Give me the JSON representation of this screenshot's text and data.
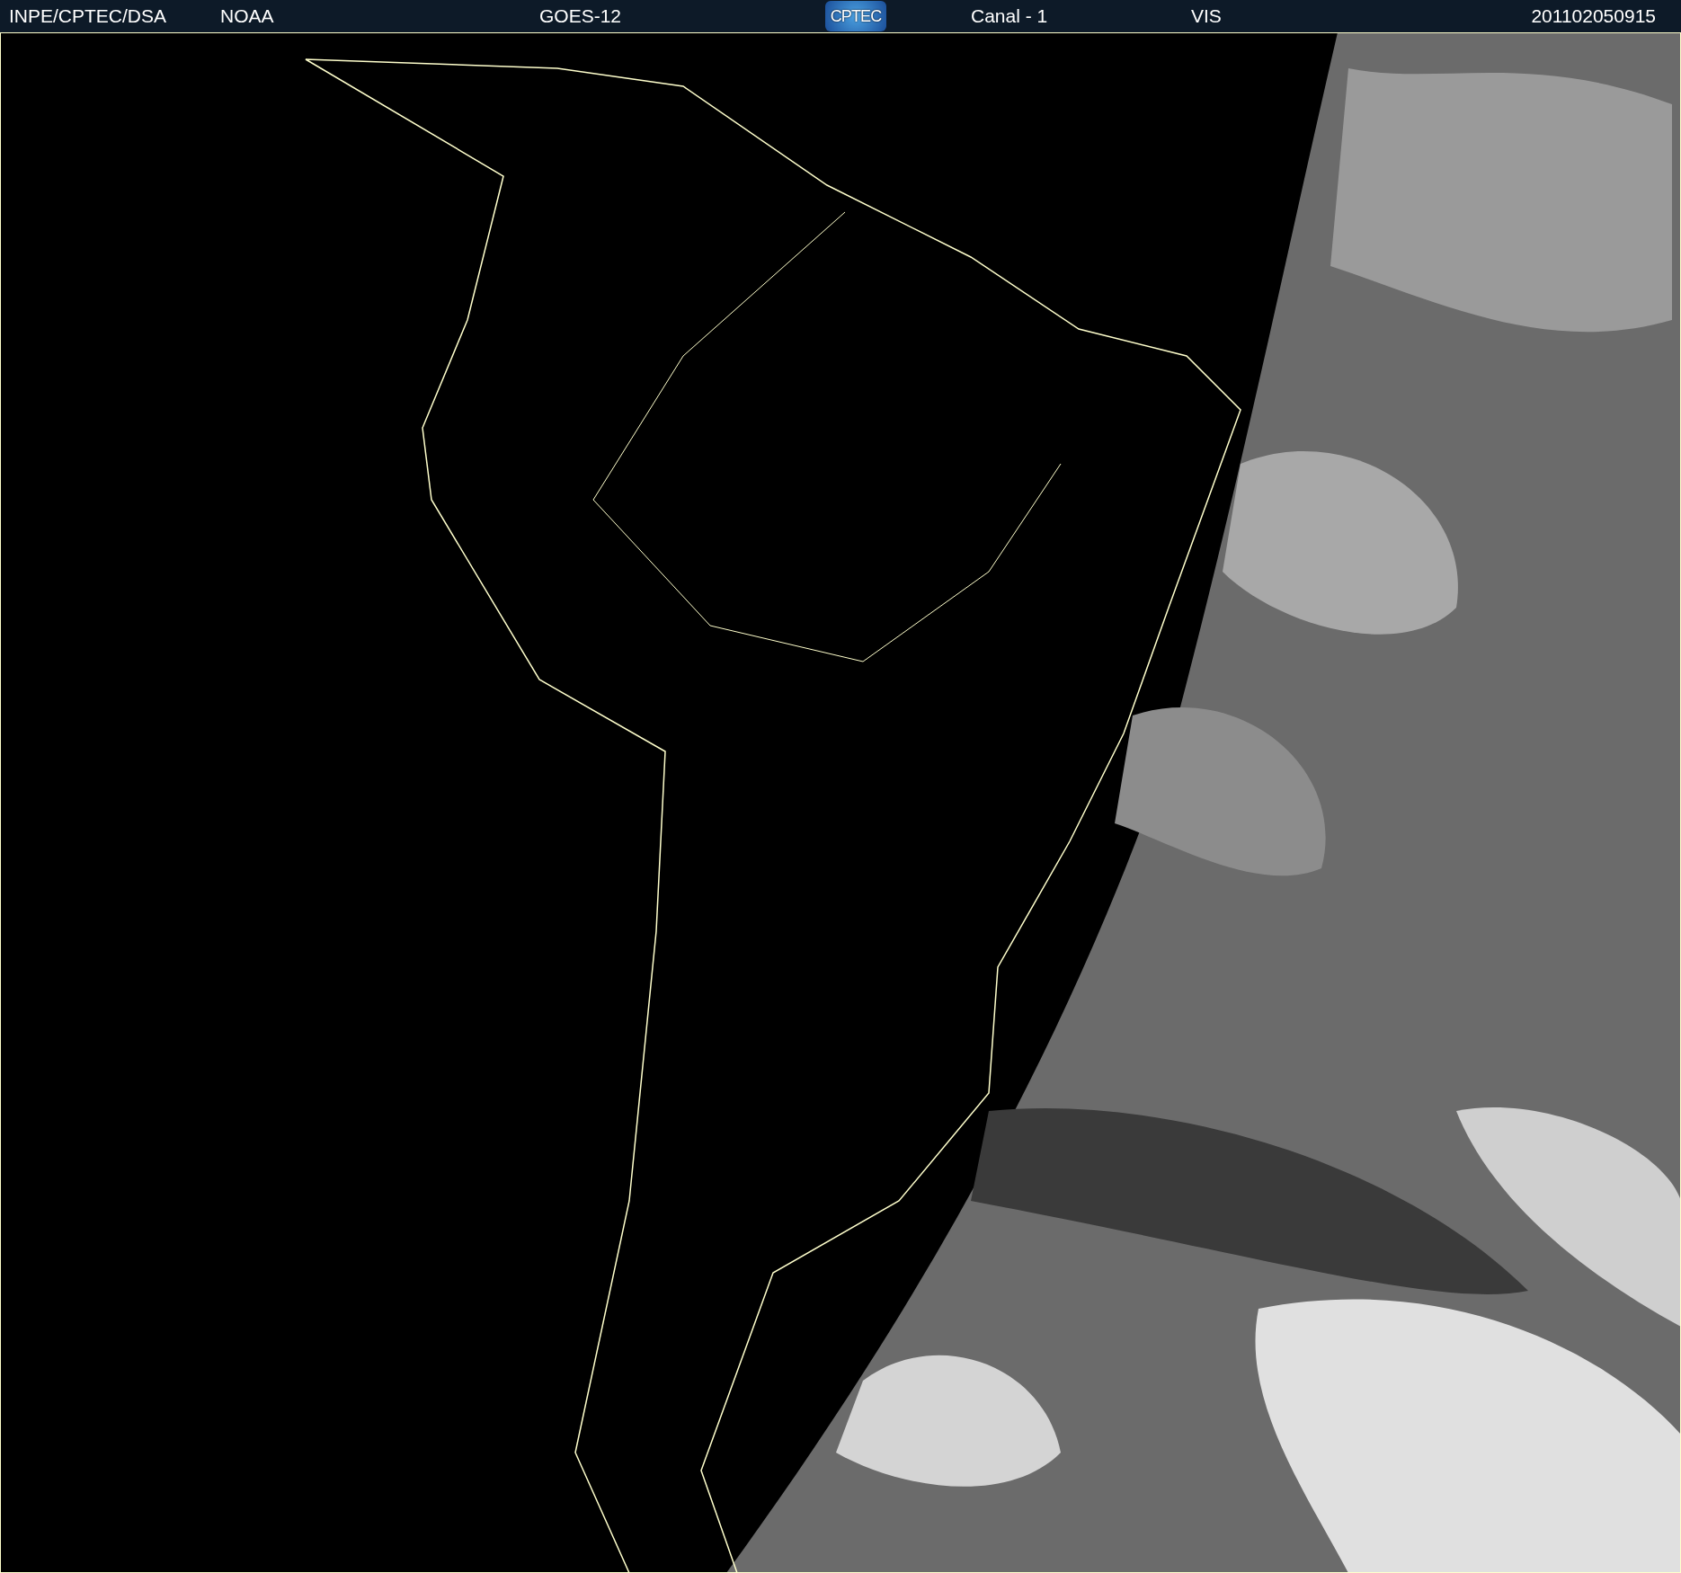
{
  "header": {
    "source": "INPE/CPTEC/DSA",
    "agency": "NOAA",
    "satellite": "GOES-12",
    "logo": "CPTEC",
    "channel": "Canal - 1",
    "band": "VIS",
    "timestamp": "201102050915"
  }
}
